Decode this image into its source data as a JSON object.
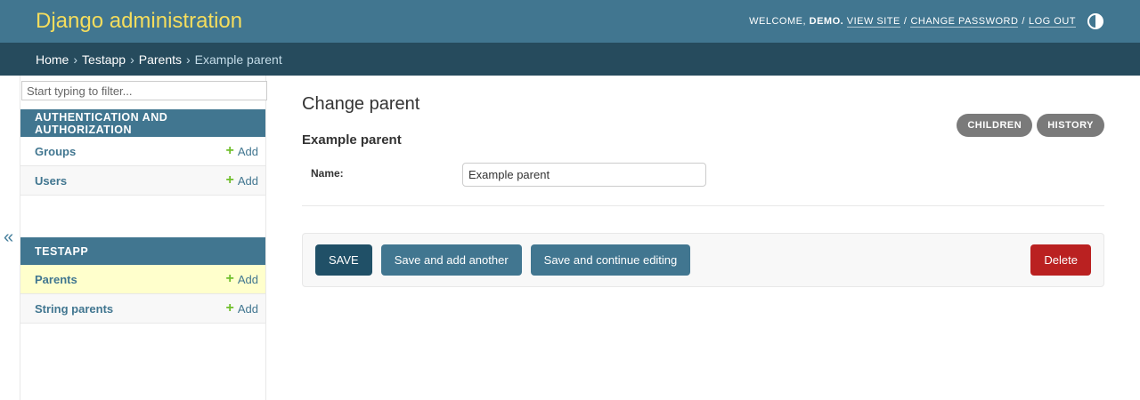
{
  "header": {
    "site_name": "Django administration",
    "welcome_prefix": "Welcome,",
    "username": "Demo.",
    "view_site": "View site",
    "change_password": "Change password",
    "log_out": "Log out",
    "separator": "/"
  },
  "breadcrumbs": {
    "home": "Home",
    "app": "Testapp",
    "model": "Parents",
    "current": "Example parent",
    "arrow": "›"
  },
  "sidebar": {
    "toggle_glyph": "«",
    "filter_placeholder": "Start typing to filter...",
    "add_label": "Add",
    "apps": [
      {
        "caption": "Authentication and Authorization",
        "models": [
          {
            "name": "Groups"
          },
          {
            "name": "Users"
          }
        ]
      },
      {
        "caption": "Testapp",
        "models": [
          {
            "name": "Parents"
          },
          {
            "name": "String parents"
          }
        ]
      }
    ]
  },
  "content": {
    "title": "Change parent",
    "object_name": "Example parent",
    "object_tools": {
      "children": "Children",
      "history": "History"
    },
    "fields": {
      "name_label": "Name:",
      "name_value": "Example parent"
    },
    "submit": {
      "save": "Save",
      "save_add_another": "Save and add another",
      "save_continue": "Save and continue editing",
      "delete": "Delete"
    }
  },
  "colors": {
    "header_bg": "#417690",
    "site_name": "#f5dd5d",
    "breadcrumbs_bg": "#264b5d",
    "selected_row": "#ffffcc",
    "save_button": "#205067",
    "delete_button": "#ba2121",
    "add_plus": "#70bf2b"
  },
  "icons": {
    "theme_toggle": "half-circle-theme-icon",
    "add": "plus-icon",
    "collapse": "double-chevron-left-icon"
  }
}
